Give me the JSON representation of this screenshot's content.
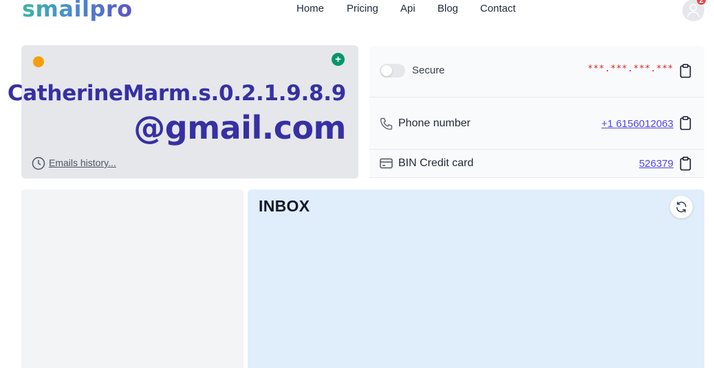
{
  "brand": {
    "logo": "smailpro"
  },
  "nav": {
    "items": [
      "Home",
      "Pricing",
      "Api",
      "Blog",
      "Contact"
    ]
  },
  "user": {
    "notification_count": "2",
    "avatar_icon": "user-icon"
  },
  "email": {
    "username": "CatherineMarm.s.0.2.1.9.8.9",
    "domain": "@gmail.com",
    "history_link": "Emails history...",
    "status_color": "#f59e0b"
  },
  "info": {
    "secure": {
      "label": "Secure",
      "value": "***.***.***.***",
      "enabled": false
    },
    "phone": {
      "label": "Phone number",
      "value": "+1 6156012063"
    },
    "bin": {
      "label": "BIN Credit card",
      "value": "526379"
    }
  },
  "inbox": {
    "title": "INBOX"
  },
  "colors": {
    "accent": "#3730a3",
    "link": "#4f46e5",
    "masked": "#dc2626",
    "inbox_bg": "#e0edfa"
  }
}
